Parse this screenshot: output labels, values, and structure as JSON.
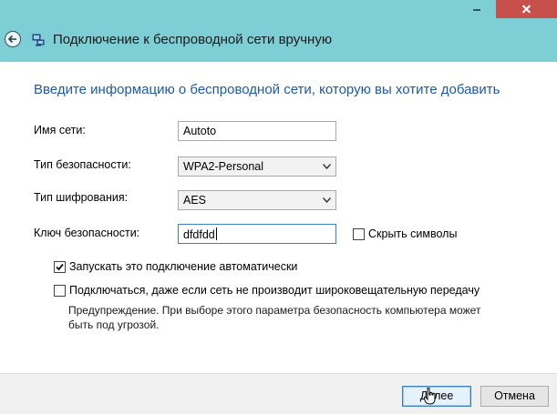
{
  "window": {
    "title": "Подключение к беспроводной сети вручную"
  },
  "heading": "Введите информацию о беспроводной сети, которую вы хотите добавить",
  "form": {
    "network_name_label": "Имя сети:",
    "network_name_value": "Autoto",
    "security_type_label": "Тип безопасности:",
    "security_type_value": "WPA2-Personal",
    "encryption_type_label": "Тип шифрования:",
    "encryption_type_value": "AES",
    "security_key_label": "Ключ безопасности:",
    "security_key_value": "dfdfdd",
    "hide_chars_label": "Скрыть символы",
    "hide_chars_checked": false
  },
  "options": {
    "auto_connect_label": "Запускать это подключение автоматически",
    "auto_connect_checked": true,
    "connect_hidden_label": "Подключаться, даже если сеть не производит широковещательную передачу",
    "connect_hidden_checked": false,
    "warning_text": "Предупреждение. При выборе этого параметра безопасность компьютера может быть под угрозой."
  },
  "buttons": {
    "next_label": "Далее",
    "cancel_label": "Отмена"
  },
  "icons": {
    "back": "back-arrow-icon",
    "network": "network-connection-icon",
    "minimize": "minimize-icon",
    "close": "close-icon",
    "dropdown": "chevron-down-icon",
    "check": "checkmark-icon",
    "cursor": "hand-cursor-icon"
  },
  "colors": {
    "titlebar": "#7ecfd5",
    "heading": "#1c5aa8",
    "close_button": "#c7504c",
    "footer": "#f0f0f0"
  }
}
